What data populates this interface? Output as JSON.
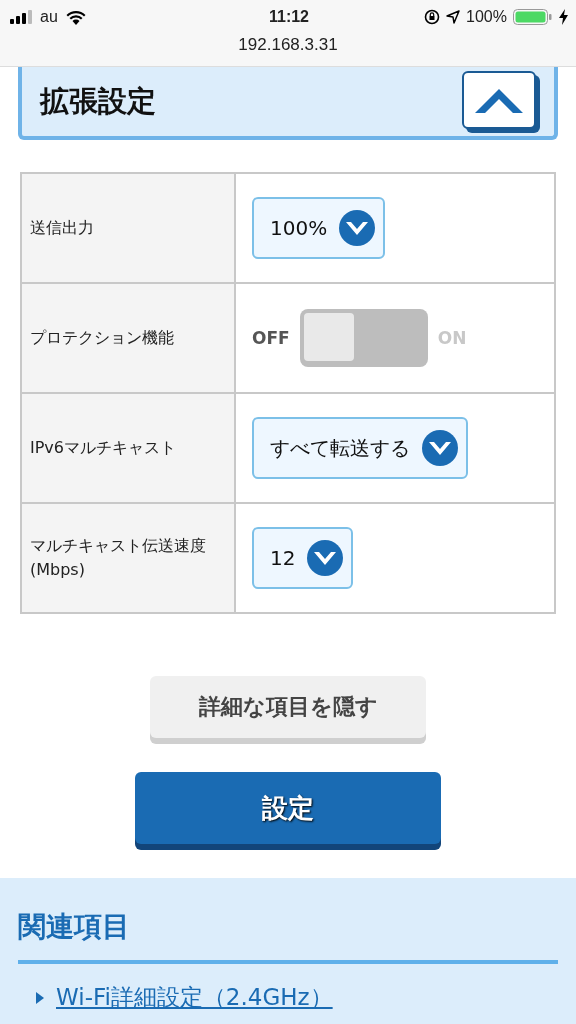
{
  "status_bar": {
    "carrier": "au",
    "time": "11:12",
    "battery": "100%"
  },
  "browser": {
    "url": "192.168.3.31"
  },
  "section": {
    "title": "拡張設定",
    "expanded": true
  },
  "rows": [
    {
      "kind": "select",
      "label": "送信出力",
      "value": "100%"
    },
    {
      "kind": "toggle",
      "label": "プロテクション機能",
      "off_label": "OFF",
      "on_label": "ON",
      "on": false
    },
    {
      "kind": "select",
      "label": "IPv6マルチキャスト",
      "value": "すべて転送する"
    },
    {
      "kind": "select",
      "label": "マルチキャスト伝送速度(Mbps)",
      "value": "12"
    }
  ],
  "buttons": {
    "hide": "詳細な項目を隠す",
    "submit": "設定"
  },
  "related": {
    "title": "関連項目",
    "links": [
      "Wi-Fi詳細設定（2.4GHz）"
    ]
  }
}
